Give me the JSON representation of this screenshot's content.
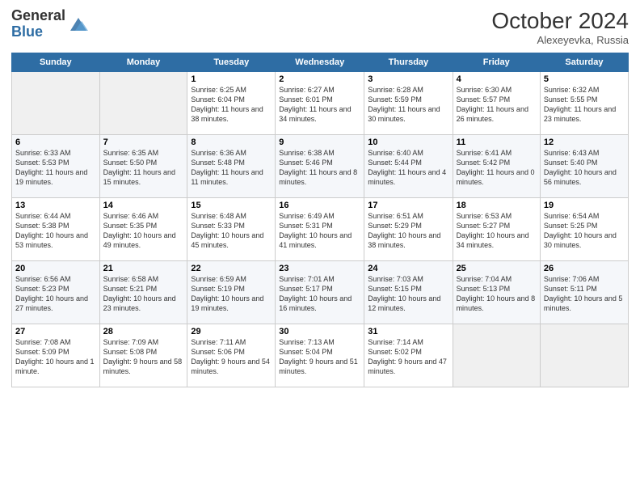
{
  "header": {
    "logo_general": "General",
    "logo_blue": "Blue",
    "month": "October 2024",
    "location": "Alexeyevka, Russia"
  },
  "days_of_week": [
    "Sunday",
    "Monday",
    "Tuesday",
    "Wednesday",
    "Thursday",
    "Friday",
    "Saturday"
  ],
  "weeks": [
    [
      {
        "day": "",
        "content": ""
      },
      {
        "day": "",
        "content": ""
      },
      {
        "day": "1",
        "content": "Sunrise: 6:25 AM\nSunset: 6:04 PM\nDaylight: 11 hours and 38 minutes."
      },
      {
        "day": "2",
        "content": "Sunrise: 6:27 AM\nSunset: 6:01 PM\nDaylight: 11 hours and 34 minutes."
      },
      {
        "day": "3",
        "content": "Sunrise: 6:28 AM\nSunset: 5:59 PM\nDaylight: 11 hours and 30 minutes."
      },
      {
        "day": "4",
        "content": "Sunrise: 6:30 AM\nSunset: 5:57 PM\nDaylight: 11 hours and 26 minutes."
      },
      {
        "day": "5",
        "content": "Sunrise: 6:32 AM\nSunset: 5:55 PM\nDaylight: 11 hours and 23 minutes."
      }
    ],
    [
      {
        "day": "6",
        "content": "Sunrise: 6:33 AM\nSunset: 5:53 PM\nDaylight: 11 hours and 19 minutes."
      },
      {
        "day": "7",
        "content": "Sunrise: 6:35 AM\nSunset: 5:50 PM\nDaylight: 11 hours and 15 minutes."
      },
      {
        "day": "8",
        "content": "Sunrise: 6:36 AM\nSunset: 5:48 PM\nDaylight: 11 hours and 11 minutes."
      },
      {
        "day": "9",
        "content": "Sunrise: 6:38 AM\nSunset: 5:46 PM\nDaylight: 11 hours and 8 minutes."
      },
      {
        "day": "10",
        "content": "Sunrise: 6:40 AM\nSunset: 5:44 PM\nDaylight: 11 hours and 4 minutes."
      },
      {
        "day": "11",
        "content": "Sunrise: 6:41 AM\nSunset: 5:42 PM\nDaylight: 11 hours and 0 minutes."
      },
      {
        "day": "12",
        "content": "Sunrise: 6:43 AM\nSunset: 5:40 PM\nDaylight: 10 hours and 56 minutes."
      }
    ],
    [
      {
        "day": "13",
        "content": "Sunrise: 6:44 AM\nSunset: 5:38 PM\nDaylight: 10 hours and 53 minutes."
      },
      {
        "day": "14",
        "content": "Sunrise: 6:46 AM\nSunset: 5:35 PM\nDaylight: 10 hours and 49 minutes."
      },
      {
        "day": "15",
        "content": "Sunrise: 6:48 AM\nSunset: 5:33 PM\nDaylight: 10 hours and 45 minutes."
      },
      {
        "day": "16",
        "content": "Sunrise: 6:49 AM\nSunset: 5:31 PM\nDaylight: 10 hours and 41 minutes."
      },
      {
        "day": "17",
        "content": "Sunrise: 6:51 AM\nSunset: 5:29 PM\nDaylight: 10 hours and 38 minutes."
      },
      {
        "day": "18",
        "content": "Sunrise: 6:53 AM\nSunset: 5:27 PM\nDaylight: 10 hours and 34 minutes."
      },
      {
        "day": "19",
        "content": "Sunrise: 6:54 AM\nSunset: 5:25 PM\nDaylight: 10 hours and 30 minutes."
      }
    ],
    [
      {
        "day": "20",
        "content": "Sunrise: 6:56 AM\nSunset: 5:23 PM\nDaylight: 10 hours and 27 minutes."
      },
      {
        "day": "21",
        "content": "Sunrise: 6:58 AM\nSunset: 5:21 PM\nDaylight: 10 hours and 23 minutes."
      },
      {
        "day": "22",
        "content": "Sunrise: 6:59 AM\nSunset: 5:19 PM\nDaylight: 10 hours and 19 minutes."
      },
      {
        "day": "23",
        "content": "Sunrise: 7:01 AM\nSunset: 5:17 PM\nDaylight: 10 hours and 16 minutes."
      },
      {
        "day": "24",
        "content": "Sunrise: 7:03 AM\nSunset: 5:15 PM\nDaylight: 10 hours and 12 minutes."
      },
      {
        "day": "25",
        "content": "Sunrise: 7:04 AM\nSunset: 5:13 PM\nDaylight: 10 hours and 8 minutes."
      },
      {
        "day": "26",
        "content": "Sunrise: 7:06 AM\nSunset: 5:11 PM\nDaylight: 10 hours and 5 minutes."
      }
    ],
    [
      {
        "day": "27",
        "content": "Sunrise: 7:08 AM\nSunset: 5:09 PM\nDaylight: 10 hours and 1 minute."
      },
      {
        "day": "28",
        "content": "Sunrise: 7:09 AM\nSunset: 5:08 PM\nDaylight: 9 hours and 58 minutes."
      },
      {
        "day": "29",
        "content": "Sunrise: 7:11 AM\nSunset: 5:06 PM\nDaylight: 9 hours and 54 minutes."
      },
      {
        "day": "30",
        "content": "Sunrise: 7:13 AM\nSunset: 5:04 PM\nDaylight: 9 hours and 51 minutes."
      },
      {
        "day": "31",
        "content": "Sunrise: 7:14 AM\nSunset: 5:02 PM\nDaylight: 9 hours and 47 minutes."
      },
      {
        "day": "",
        "content": ""
      },
      {
        "day": "",
        "content": ""
      }
    ]
  ]
}
